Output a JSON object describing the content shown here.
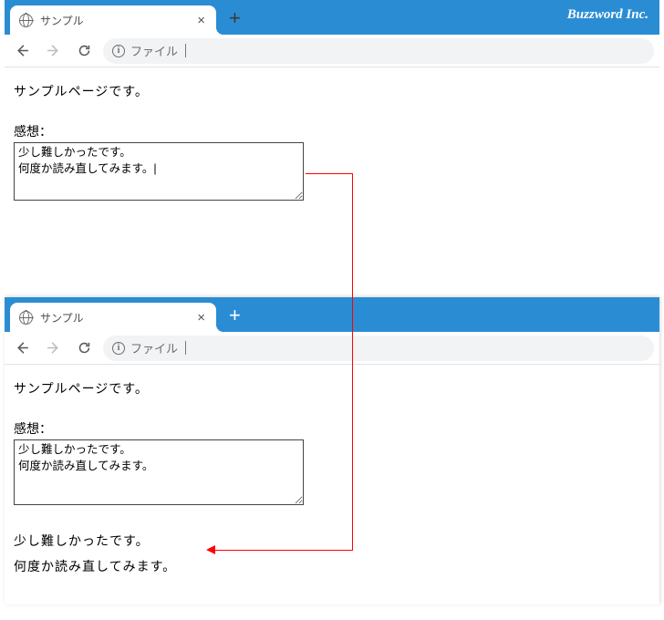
{
  "brand": "Buzzword Inc.",
  "win1": {
    "tab_title": "サンプル",
    "addr": "ファイル",
    "page_text": "サンプルページです。",
    "label": "感想：",
    "textarea_value": "少し難しかったです。\n何度か読み直してみます。|"
  },
  "win2": {
    "tab_title": "サンプル",
    "addr": "ファイル",
    "page_text": "サンプルページです。",
    "label": "感想：",
    "textarea_value": "少し難しかったです。\n何度か読み直してみます。",
    "output_line1": "少し難しかったです。",
    "output_line2": "何度か読み直してみます。"
  }
}
